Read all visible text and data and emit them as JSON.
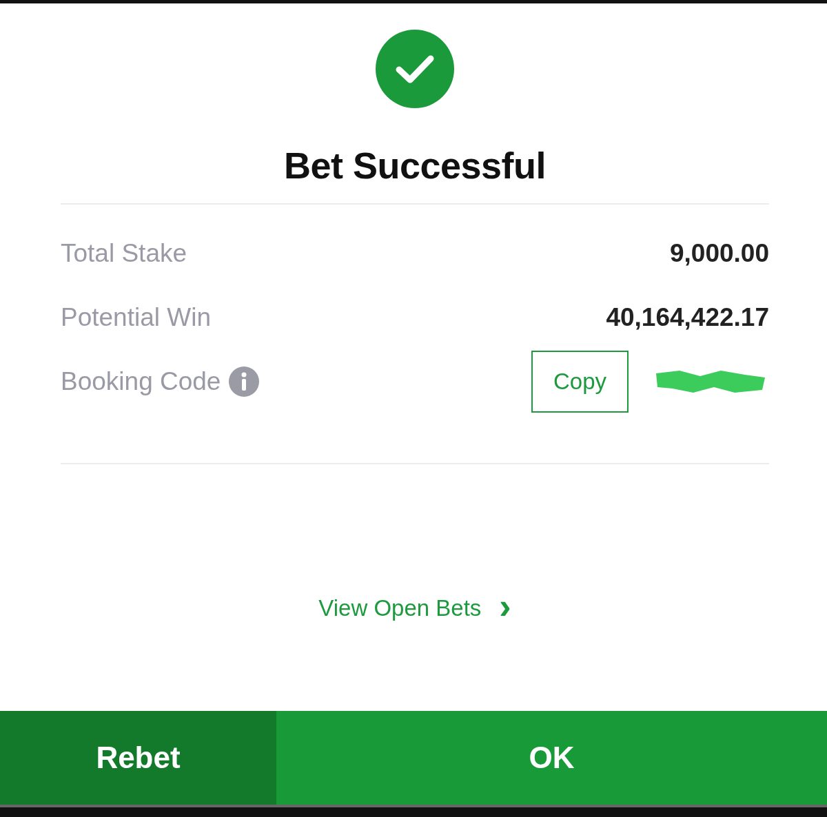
{
  "title": "Bet Successful",
  "rows": [
    {
      "kind": "value",
      "label": "Total Stake",
      "value": "9,000.00"
    },
    {
      "kind": "value",
      "label": "Potential Win",
      "value": "40,164,422.17"
    },
    {
      "kind": "code",
      "label": "Booking Code",
      "button": "Copy"
    }
  ],
  "link": {
    "label": "View Open Bets",
    "arrow": "›"
  },
  "buttons": [
    {
      "label": "Rebet",
      "kind": "secondary"
    },
    {
      "label": "OK",
      "kind": "primary"
    }
  ]
}
